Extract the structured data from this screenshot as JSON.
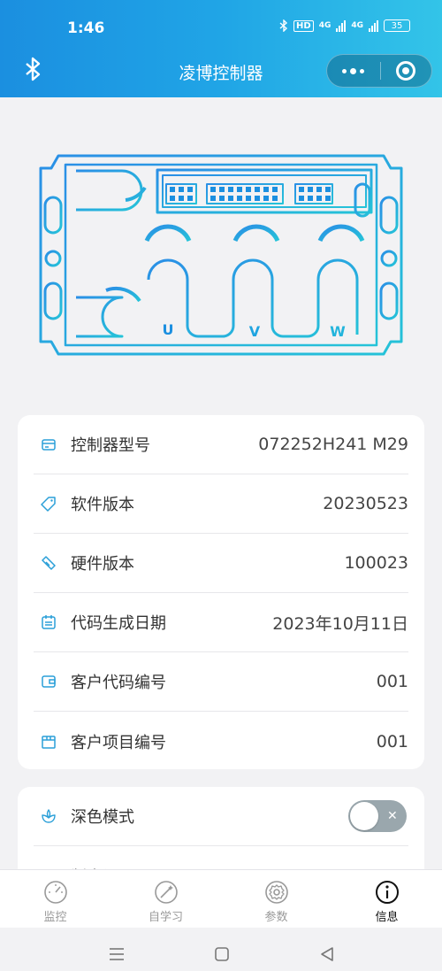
{
  "status_bar": {
    "time": "1:46",
    "network_1": "4G",
    "network_2": "4G",
    "hd": "HD",
    "battery": "35"
  },
  "nav": {
    "title": "凌博控制器"
  },
  "device": {
    "phase_labels": [
      "U",
      "V",
      "W"
    ]
  },
  "info": {
    "rows": [
      {
        "label": "控制器型号",
        "value": "072252H241 M29",
        "icon": "card-icon"
      },
      {
        "label": "软件版本",
        "value": "20230523",
        "icon": "tag-icon"
      },
      {
        "label": "硬件版本",
        "value": "100023",
        "icon": "ticket-icon"
      },
      {
        "label": "代码生成日期",
        "value": "2023年10月11日",
        "icon": "calendar-icon"
      },
      {
        "label": "客户代码编号",
        "value": "001",
        "icon": "wallet-icon"
      },
      {
        "label": "客户项目编号",
        "value": "001",
        "icon": "box-icon"
      }
    ]
  },
  "settings": {
    "dark_mode_label": "深色模式",
    "dark_mode_on": false,
    "second_row_label": "版本记录"
  },
  "tabbar": {
    "tabs": [
      {
        "label": "监控",
        "icon": "gauge-icon"
      },
      {
        "label": "自学习",
        "icon": "magic-wand-icon"
      },
      {
        "label": "参数",
        "icon": "gear-icon"
      },
      {
        "label": "信息",
        "icon": "info-icon",
        "active": true
      }
    ]
  },
  "colors": {
    "header_start": "#1b8fe0",
    "header_end": "#33c4e8",
    "accent": "#2196f3",
    "device_stroke": "#1aa3e8"
  }
}
